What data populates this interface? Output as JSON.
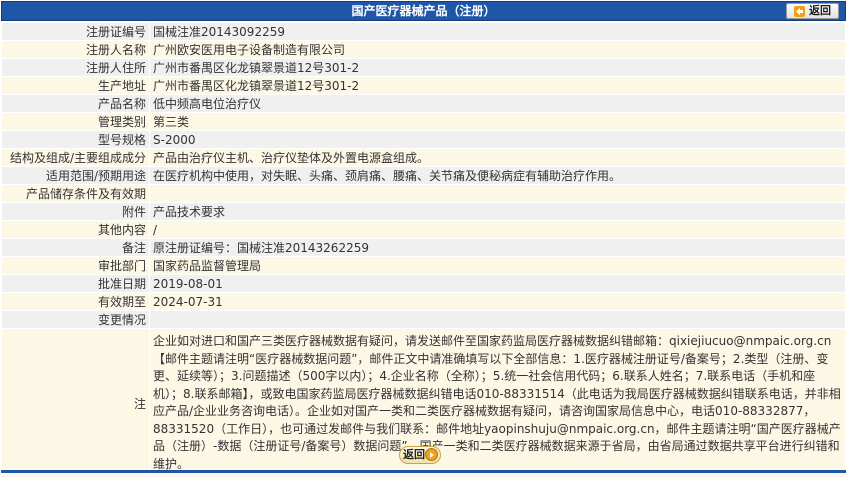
{
  "header": {
    "title": "国产医疗器械产品（注册）",
    "back_label": "返回"
  },
  "fields": [
    {
      "label": "注册证编号",
      "value": "国械注准20143092259"
    },
    {
      "label": "注册人名称",
      "value": "广州欧安医用电子设备制造有限公司"
    },
    {
      "label": "注册人住所",
      "value": "广州市番禺区化龙镇翠景道12号301-2"
    },
    {
      "label": "生产地址",
      "value": "广州市番禺区化龙镇翠景道12号301-2"
    },
    {
      "label": "产品名称",
      "value": "低中频高电位治疗仪"
    },
    {
      "label": "管理类别",
      "value": "第三类"
    },
    {
      "label": "型号规格",
      "value": "S-2000"
    },
    {
      "label": "结构及组成/主要组成成分",
      "value": "产品由治疗仪主机、治疗仪垫体及外置电源盒组成。"
    },
    {
      "label": "适用范围/预期用途",
      "value": "在医疗机构中使用，对失眠、头痛、颈肩痛、腰痛、关节痛及便秘病症有辅助治疗作用。"
    },
    {
      "label": "产品储存条件及有效期",
      "value": ""
    },
    {
      "label": "附件",
      "value": "产品技术要求"
    },
    {
      "label": "其他内容",
      "value": "/"
    },
    {
      "label": "备注",
      "value": "原注册证编号：国械注准20143262259"
    },
    {
      "label": "审批部门",
      "value": "国家药品监督管理局"
    },
    {
      "label": "批准日期",
      "value": "2019-08-01"
    },
    {
      "label": "有效期至",
      "value": "2024-07-31"
    },
    {
      "label": "变更情况",
      "value": ""
    }
  ],
  "note": {
    "label": "注",
    "text": "企业如对进口和国产三类医疗器械数据有疑问，请发送邮件至国家药监局医疗器械数据纠错邮箱：qixiejiucuo@nmpaic.org.cn【邮件主题请注明“医疗器械数据问题”，邮件正文中请准确填写以下全部信息：1.医疗器械注册证号/备案号；2.类型（注册、变更、延续等）；3.问题描述（500字以内）；4.企业名称（全称）；5.统一社会信用代码；6.联系人姓名；7.联系电话（手机和座机）；8.联系邮箱】，或致电国家药监局医疗器械数据纠错电话010-88331514（此电话为我局医疗器械数据纠错联系电话，并非相应产品/企业业务咨询电话）。企业如对国产一类和二类医疗器械数据有疑问，请咨询国家局信息中心，电话010-88332877，88331520（工作日），也可通过发邮件与我们联系：邮件地址yaopinshuju@nmpaic.org.cn，邮件主题请注明“国产医疗器械产品（注册）-数据（注册证号/备案号）数据问题”。国产一类和二类医疗器械数据来源于省局，由省局通过数据共享平台进行纠错和维护。"
  },
  "footer": {
    "back_label": "返回"
  },
  "colors": {
    "header_bg": "#1f56a8",
    "row_bg": "#f0f0f0",
    "row_alt_bg": "#fdf7e6"
  }
}
